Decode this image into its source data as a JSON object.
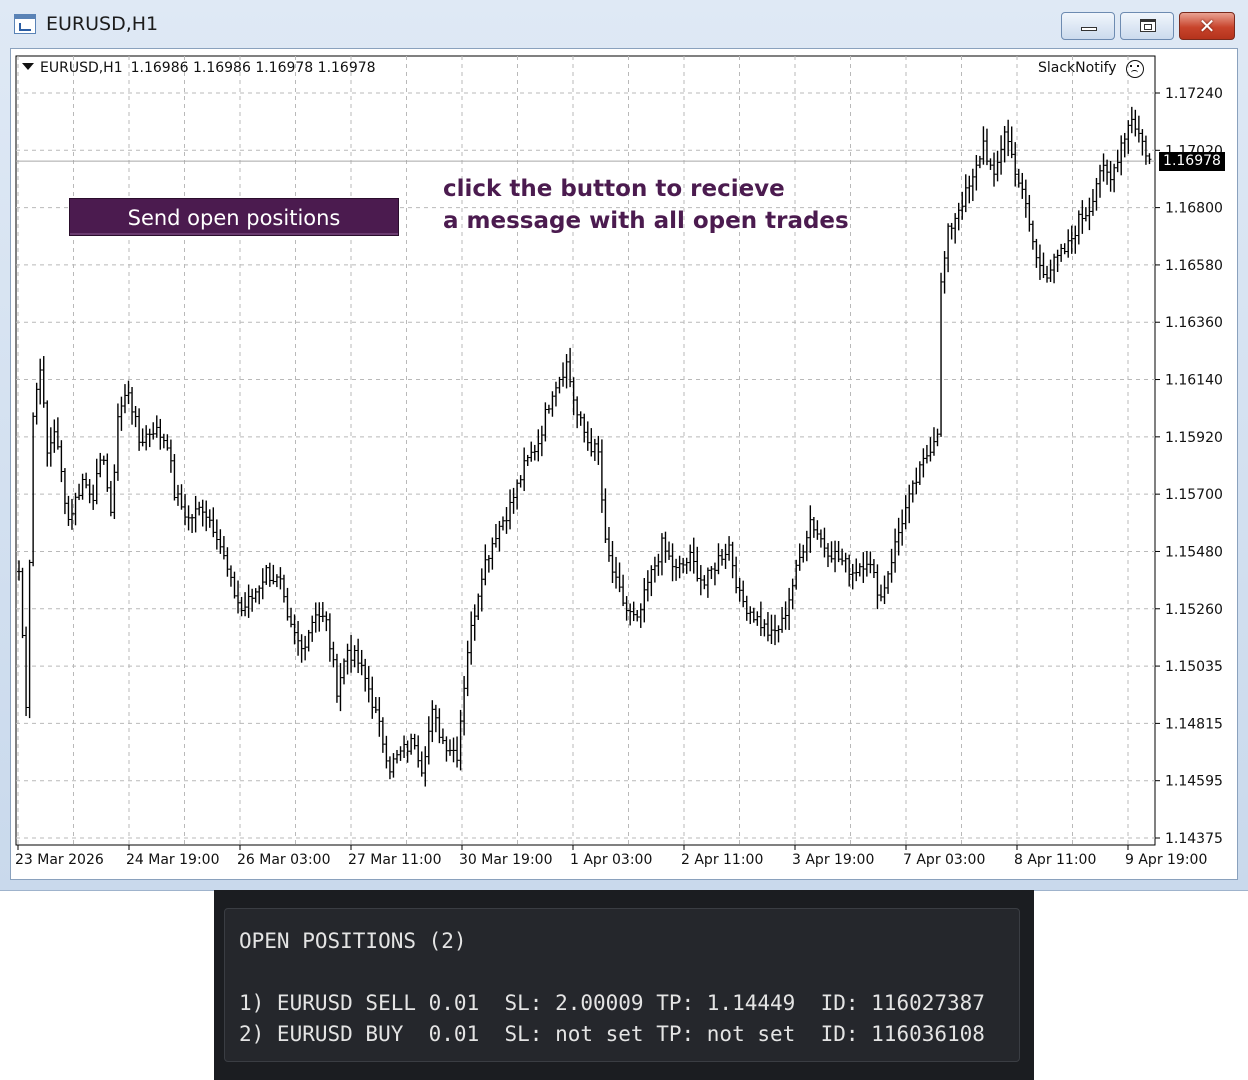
{
  "window": {
    "title": "EURUSD,H1"
  },
  "chart": {
    "header_symbol": "EURUSD,H1",
    "header_ohlc": "1.16986 1.16986 1.16978 1.16978",
    "ea_name": "SlackNotify",
    "current_price": "1.16978",
    "button_label": "Send open positions",
    "hint_line1": "click the button to recieve",
    "hint_line2": "a message with all open trades"
  },
  "chart_data": {
    "type": "bar",
    "timeframe": "H1",
    "symbol": "EURUSD",
    "y_ticks": [
      "1.17240",
      "1.17020",
      "1.16800",
      "1.16580",
      "1.16360",
      "1.16140",
      "1.15920",
      "1.15700",
      "1.15480",
      "1.15260",
      "1.15035",
      "1.14815",
      "1.14595",
      "1.14375"
    ],
    "x_ticks": [
      "23 Mar 2026",
      "24 Mar 19:00",
      "26 Mar 03:00",
      "27 Mar 11:00",
      "30 Mar 19:00",
      "1 Apr 03:00",
      "2 Apr 11:00",
      "3 Apr 19:00",
      "7 Apr 03:00",
      "8 Apr 11:00",
      "9 Apr 19:00"
    ],
    "ylim": [
      1.14375,
      1.1724
    ],
    "grid": true,
    "close_path": [
      [
        0,
        1.154
      ],
      [
        2,
        1.149
      ],
      [
        4,
        1.16
      ],
      [
        6,
        1.162
      ],
      [
        8,
        1.1585
      ],
      [
        10,
        1.1595
      ],
      [
        14,
        1.156
      ],
      [
        18,
        1.1575
      ],
      [
        21,
        1.157
      ],
      [
        24,
        1.1585
      ],
      [
        26,
        1.156
      ],
      [
        28,
        1.16
      ],
      [
        31,
        1.161
      ],
      [
        34,
        1.159
      ],
      [
        38,
        1.1595
      ],
      [
        42,
        1.159
      ],
      [
        44,
        1.157
      ],
      [
        48,
        1.156
      ],
      [
        52,
        1.1565
      ],
      [
        56,
        1.1555
      ],
      [
        60,
        1.1535
      ],
      [
        63,
        1.1525
      ],
      [
        66,
        1.153
      ],
      [
        70,
        1.154
      ],
      [
        74,
        1.1535
      ],
      [
        76,
        1.152
      ],
      [
        80,
        1.151
      ],
      [
        84,
        1.1525
      ],
      [
        87,
        1.152
      ],
      [
        90,
        1.1495
      ],
      [
        93,
        1.151
      ],
      [
        96,
        1.1505
      ],
      [
        99,
        1.1495
      ],
      [
        102,
        1.148
      ],
      [
        105,
        1.1465
      ],
      [
        108,
        1.147
      ],
      [
        112,
        1.1475
      ],
      [
        114,
        1.1465
      ],
      [
        117,
        1.1485
      ],
      [
        120,
        1.1475
      ],
      [
        124,
        1.147
      ],
      [
        127,
        1.151
      ],
      [
        131,
        1.154
      ],
      [
        135,
        1.1555
      ],
      [
        139,
        1.1565
      ],
      [
        143,
        1.158
      ],
      [
        147,
        1.159
      ],
      [
        151,
        1.161
      ],
      [
        155,
        1.162
      ],
      [
        158,
        1.16
      ],
      [
        161,
        1.159
      ],
      [
        164,
        1.1585
      ],
      [
        166,
        1.155
      ],
      [
        169,
        1.1535
      ],
      [
        172,
        1.1525
      ],
      [
        175,
        1.152
      ],
      [
        178,
        1.1535
      ],
      [
        182,
        1.155
      ],
      [
        186,
        1.154
      ],
      [
        190,
        1.1545
      ],
      [
        194,
        1.1535
      ],
      [
        198,
        1.1545
      ],
      [
        201,
        1.155
      ],
      [
        204,
        1.153
      ],
      [
        207,
        1.1525
      ],
      [
        210,
        1.152
      ],
      [
        213,
        1.1515
      ],
      [
        216,
        1.152
      ],
      [
        220,
        1.154
      ],
      [
        224,
        1.156
      ],
      [
        228,
        1.155
      ],
      [
        232,
        1.1545
      ],
      [
        236,
        1.154
      ],
      [
        240,
        1.1545
      ],
      [
        244,
        1.153
      ],
      [
        247,
        1.1545
      ],
      [
        250,
        1.156
      ],
      [
        254,
        1.1575
      ],
      [
        257,
        1.1585
      ],
      [
        260,
        1.1595
      ],
      [
        261,
        1.165
      ],
      [
        263,
        1.167
      ],
      [
        266,
        1.168
      ],
      [
        270,
        1.169
      ],
      [
        273,
        1.1705
      ],
      [
        276,
        1.169
      ],
      [
        279,
        1.171
      ],
      [
        282,
        1.1695
      ],
      [
        285,
        1.168
      ],
      [
        288,
        1.166
      ],
      [
        291,
        1.1655
      ],
      [
        294,
        1.166
      ],
      [
        297,
        1.1665
      ],
      [
        300,
        1.1675
      ],
      [
        303,
        1.168
      ],
      [
        306,
        1.1695
      ],
      [
        309,
        1.169
      ],
      [
        312,
        1.1705
      ],
      [
        315,
        1.1715
      ],
      [
        318,
        1.1705
      ],
      [
        320,
        1.1698
      ]
    ]
  },
  "terminal": {
    "title": "OPEN POSITIONS (2)",
    "rows": [
      "1) EURUSD SELL 0.01  SL: 2.00009 TP: 1.14449  ID: 116027387",
      "2) EURUSD BUY  0.01  SL: not set TP: not set  ID: 116036108"
    ]
  }
}
